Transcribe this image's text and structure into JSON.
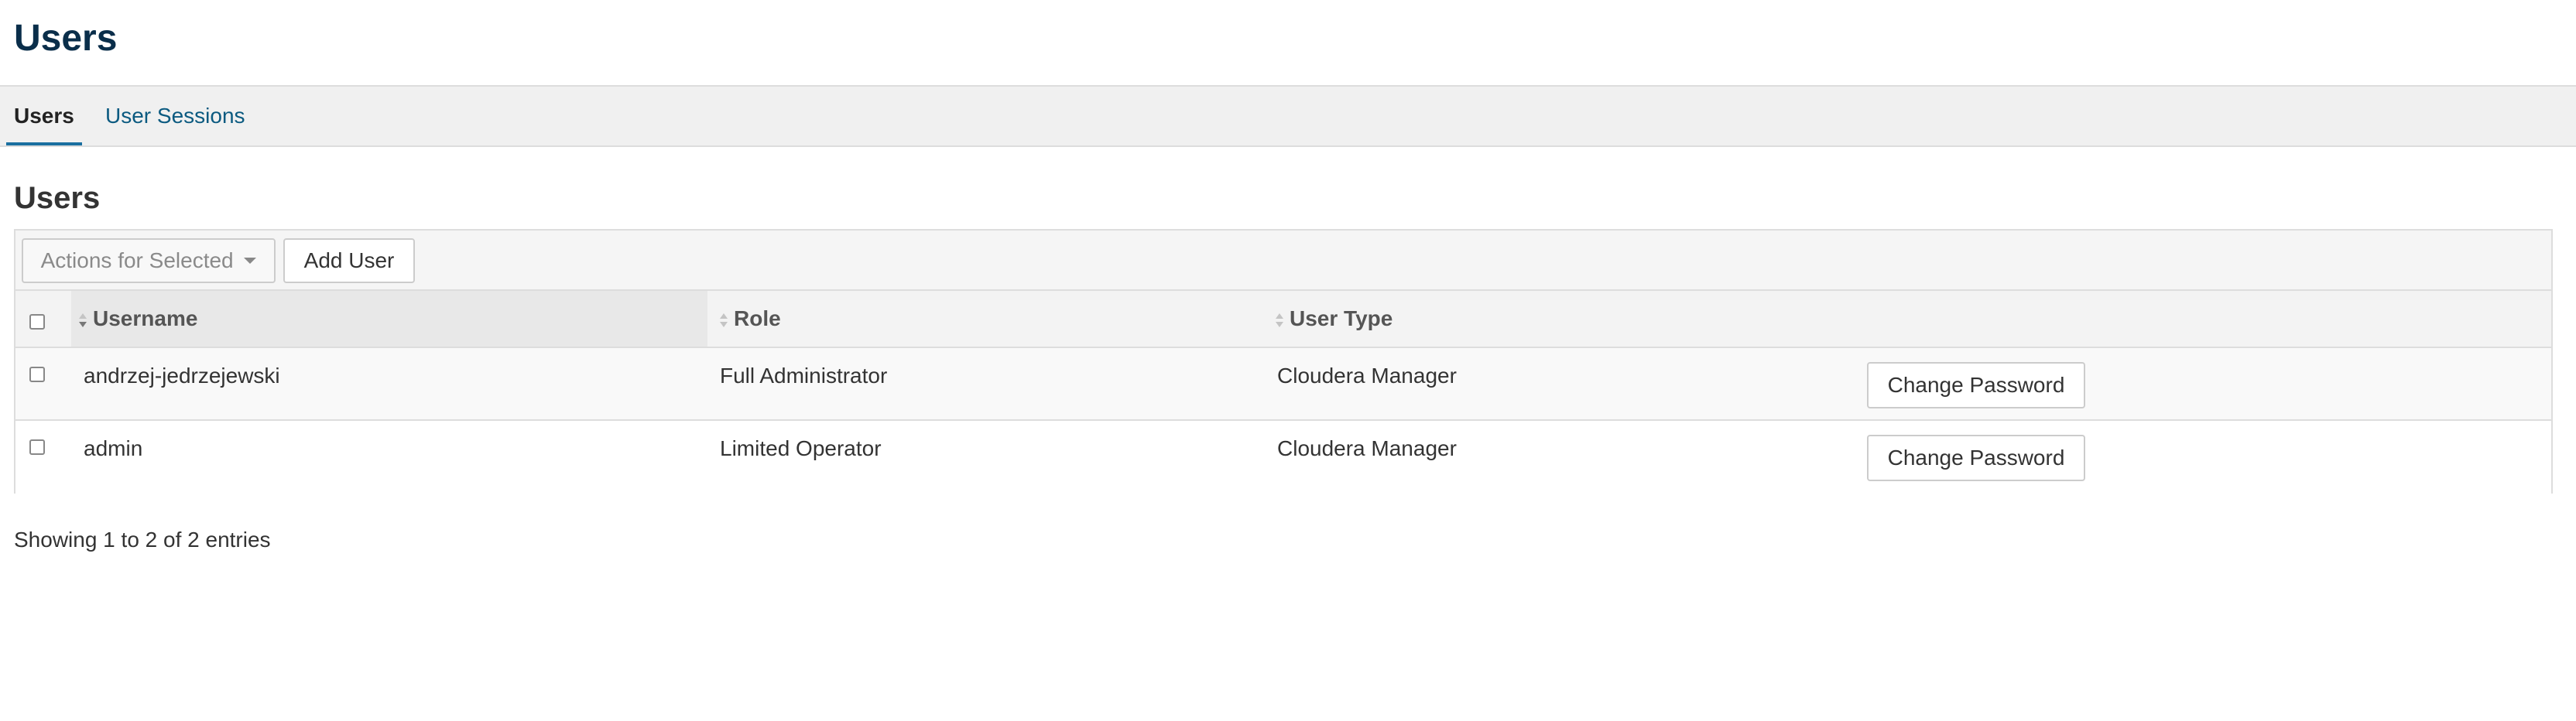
{
  "page": {
    "title": "Users"
  },
  "tabs": [
    {
      "label": "Users",
      "active": true
    },
    {
      "label": "User Sessions",
      "active": false
    }
  ],
  "section": {
    "title": "Users"
  },
  "toolbar": {
    "actions_label": "Actions for Selected",
    "add_user_label": "Add User"
  },
  "table": {
    "columns": [
      "Username",
      "Role",
      "User Type"
    ],
    "rows": [
      {
        "username": "andrzej-jedrzejewski",
        "role": "Full Administrator",
        "user_type": "Cloudera Manager",
        "action": "Change Password"
      },
      {
        "username": "admin",
        "role": "Limited Operator",
        "user_type": "Cloudera Manager",
        "action": "Change Password"
      }
    ]
  },
  "footer": {
    "info": "Showing 1 to 2 of 2 entries"
  },
  "colors": {
    "title": "#0a2e4a",
    "link": "#0b5a80",
    "active_tab_underline": "#1a6fa0"
  }
}
